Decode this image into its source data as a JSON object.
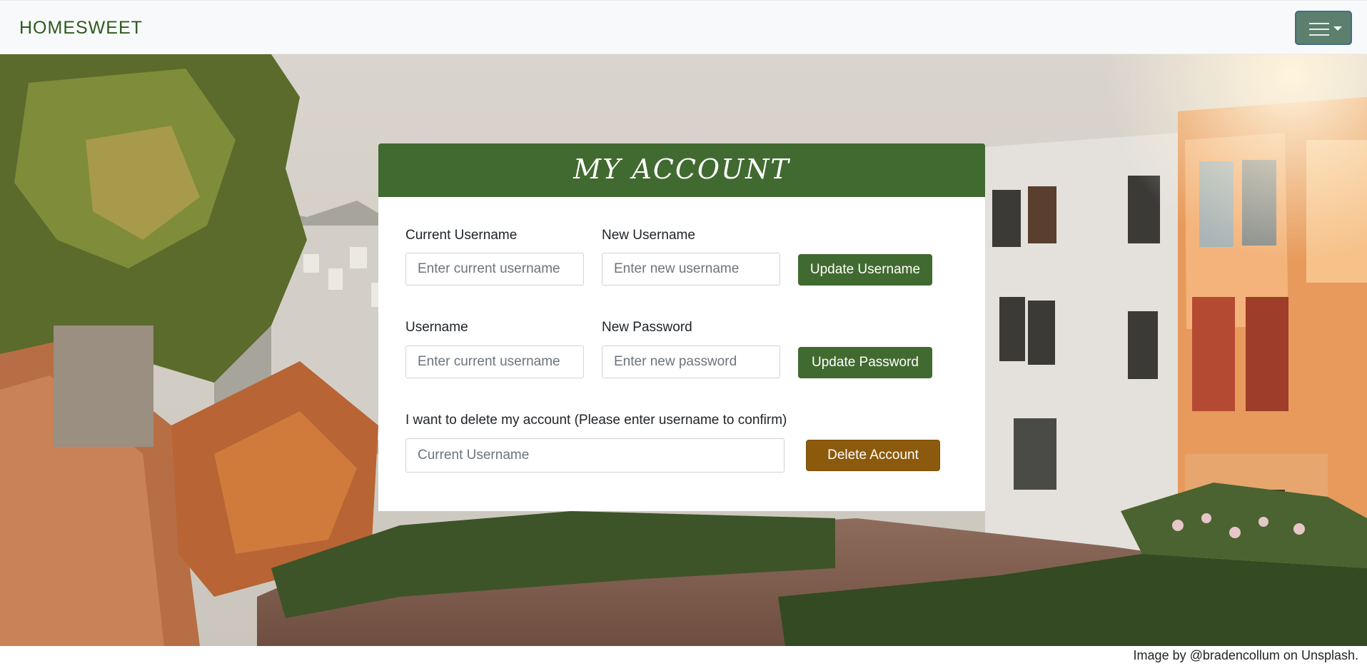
{
  "navbar": {
    "brand": "HOMESWEET",
    "menu_icon": "hamburger-menu-icon"
  },
  "card": {
    "title": "MY ACCOUNT",
    "update_username": {
      "current_label": "Current Username",
      "current_placeholder": "Enter current username",
      "new_label": "New Username",
      "new_placeholder": "Enter new username",
      "button": "Update Username"
    },
    "update_password": {
      "username_label": "Username",
      "username_placeholder": "Enter current username",
      "new_label": "New Password",
      "new_placeholder": "Enter new password",
      "button": "Update Password"
    },
    "delete_account": {
      "label": "I want to delete my account (Please enter username to confirm)",
      "placeholder": "Current Username",
      "button": "Delete Account"
    }
  },
  "footer": {
    "credit": "Image by @bradencollum on Unsplash."
  },
  "colors": {
    "brand_green": "#416a30",
    "delete_gold": "#8c5a0c",
    "menu_button": "#5d7f6e",
    "navbar_bg": "#f8f9fa"
  }
}
